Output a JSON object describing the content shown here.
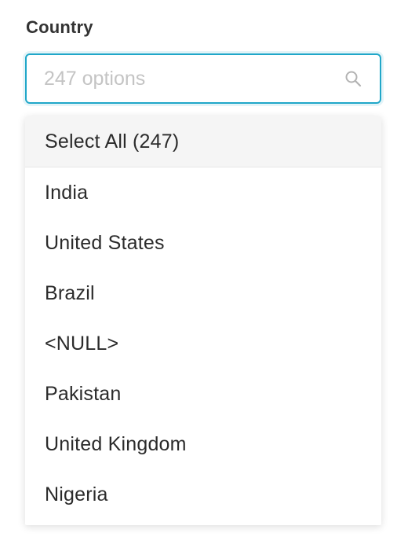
{
  "field": {
    "label": "Country"
  },
  "search": {
    "placeholder": "247 options",
    "value": "",
    "icon": "search-icon"
  },
  "dropdown": {
    "select_all_label": "Select All (247)",
    "options": [
      "India",
      "United States",
      "Brazil",
      "<NULL>",
      "Pakistan",
      "United Kingdom",
      "Nigeria"
    ]
  },
  "colors": {
    "focus_border": "#20a7c9",
    "select_all_background": "#f5f5f5",
    "placeholder": "#c4c4c4"
  }
}
